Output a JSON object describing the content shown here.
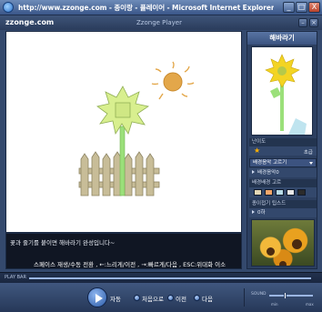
{
  "window": {
    "title": "http://www.zzonge.com - 종이랑 - 플레이어 - Microsoft Internet Explorer",
    "buttons": [
      "_",
      "□",
      "X"
    ]
  },
  "app": {
    "logo": "zzonge.com",
    "player_title": "Zzonge Player"
  },
  "stage": {
    "caption": "꽃과 줄기를 붙이면 해바라기 완성입니다~",
    "hint": "스페이스 재생/수동 전환 , ←:느리게/이전 , →:빠르게/다음 , ESC:위대화 이소"
  },
  "sidebar": {
    "title": "해바라기",
    "level_label": "난이도",
    "level_value": "초급",
    "bg_music_label": "배경음악 고르기",
    "bg_music_value": "배경음악0",
    "bg_color_label": "배경배경 고르",
    "tip_label": "종이접기 팁스드",
    "tip_value": "0하",
    "swatch_colors": [
      "#e3d7b6",
      "#f2a66b",
      "#b8dbe8",
      "#e8e8e8",
      "#2b2b2b"
    ]
  },
  "playbar": {
    "label": "PLAY BAR",
    "progress": 1.0
  },
  "controls": {
    "play_label": "자동",
    "first_label": "처음으로",
    "prev_label": "이전",
    "next_label": "다음",
    "sound_label": "SOUND",
    "vol_min_label": "min",
    "vol_max_label": "max",
    "volume": 0.35
  }
}
